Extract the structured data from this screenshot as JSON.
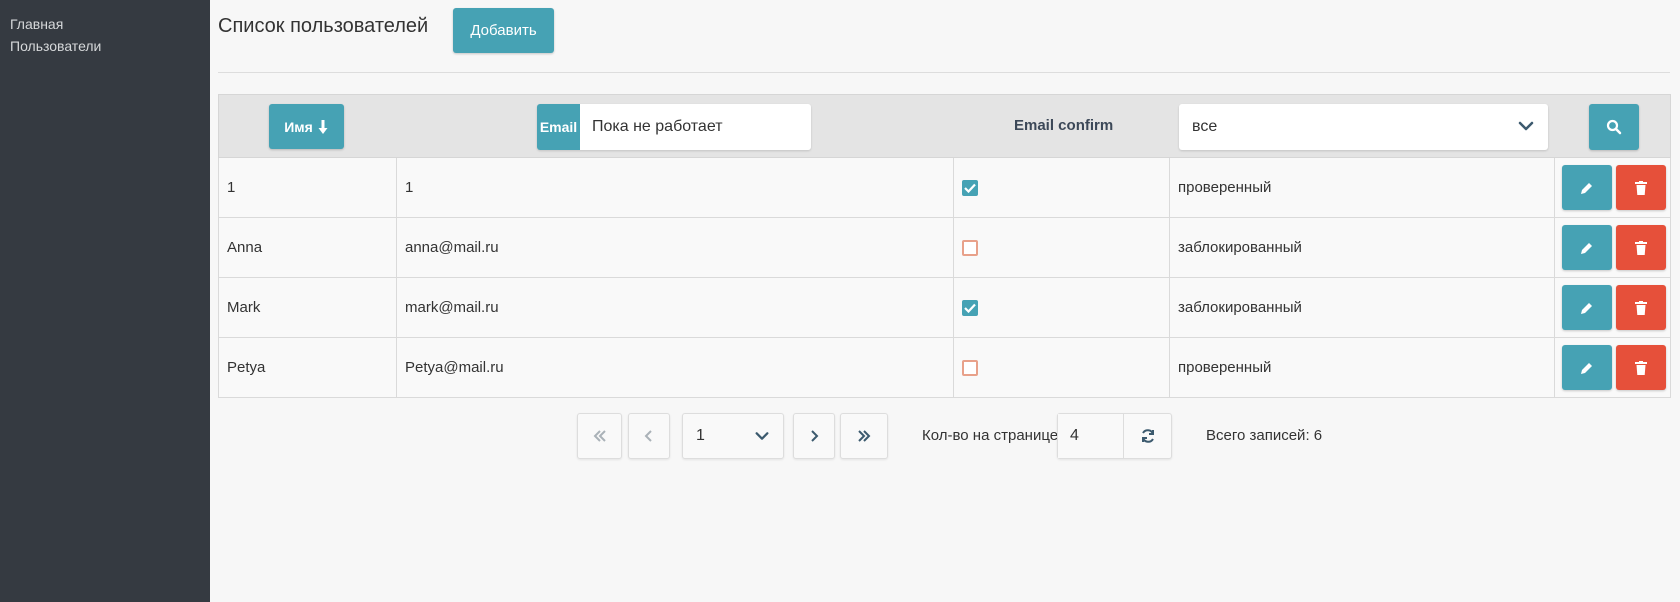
{
  "sidebar": {
    "items": [
      {
        "label": "Главная"
      },
      {
        "label": "Пользователи"
      }
    ]
  },
  "header": {
    "title": "Список пользователей",
    "add_label": "Добавить"
  },
  "table": {
    "name_sort_label": "Имя",
    "email_label": "Email",
    "email_filter_value": "Пока не работает",
    "confirm_label": "Email confirm",
    "status_filter_value": "все",
    "rows": [
      {
        "name": "1",
        "email": "1",
        "confirmed": true,
        "status": "проверенный"
      },
      {
        "name": "Anna",
        "email": "anna@mail.ru",
        "confirmed": false,
        "status": "заблокированный"
      },
      {
        "name": "Mark",
        "email": "mark@mail.ru",
        "confirmed": true,
        "status": "заблокированный"
      },
      {
        "name": "Petya",
        "email": "Petya@mail.ru",
        "confirmed": false,
        "status": "проверенный"
      }
    ]
  },
  "pagination": {
    "current_page": "1",
    "per_page_label": "Кол-во на странице:",
    "per_page_value": "4",
    "total_label": "Всего записей: 6"
  },
  "colors": {
    "sidebar_bg": "#353a41",
    "accent": "#46a2b4",
    "danger": "#e6503a"
  }
}
